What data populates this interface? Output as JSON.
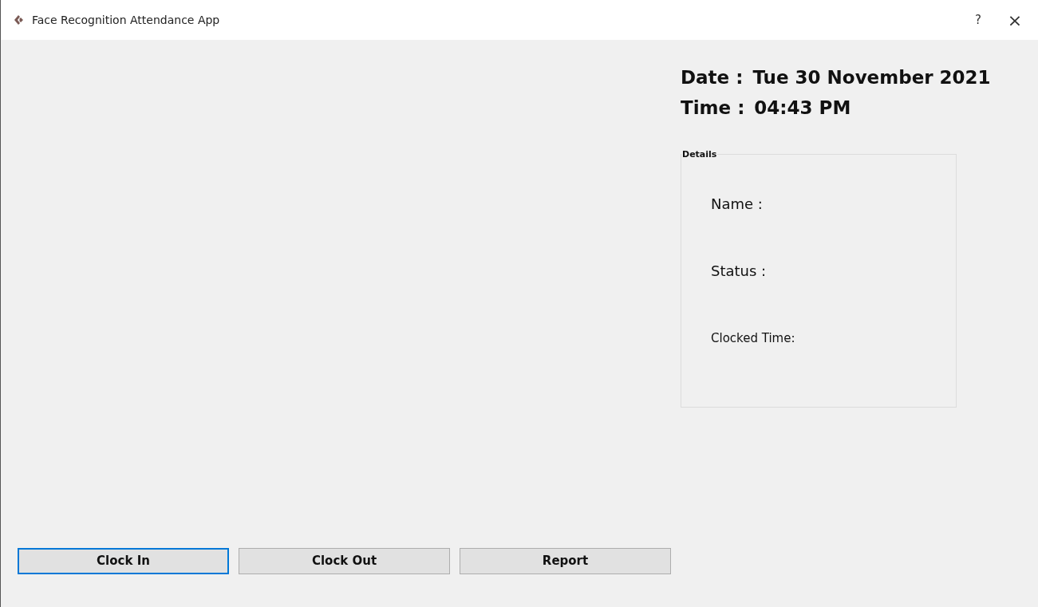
{
  "window": {
    "title": "Face Recognition Attendance App",
    "help": "?",
    "close": "×"
  },
  "date": {
    "label": "Date :",
    "value": "Tue 30 November 2021"
  },
  "time": {
    "label": "Time :",
    "value": "04:43 PM"
  },
  "details": {
    "title": "Details",
    "fields": [
      {
        "label": "Name :",
        "kind": "large"
      },
      {
        "label": "Status :",
        "kind": "large"
      },
      {
        "label": "Clocked Time:",
        "kind": "small"
      }
    ]
  },
  "buttons": [
    {
      "label": "Clock In",
      "focused": true
    },
    {
      "label": "Clock Out",
      "focused": false
    },
    {
      "label": "Report",
      "focused": false
    }
  ]
}
